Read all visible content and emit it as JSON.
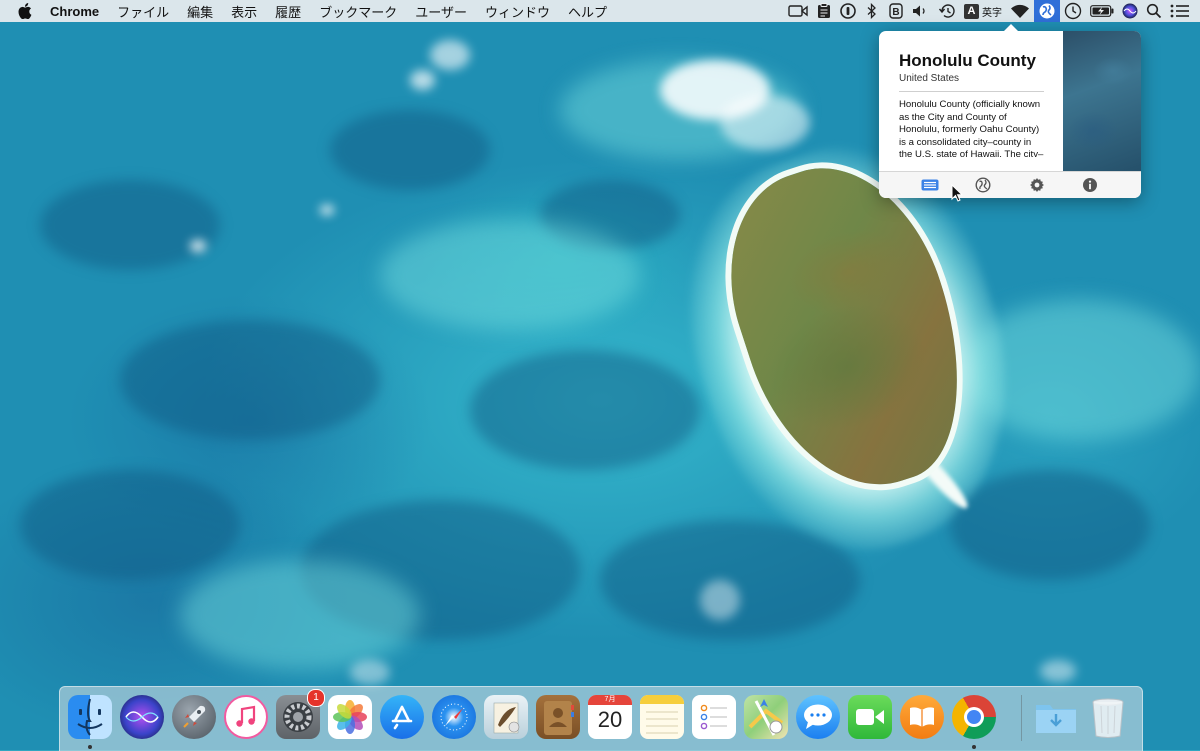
{
  "menubar": {
    "apple_icon": "apple-logo",
    "app_name": "Chrome",
    "items": [
      "ファイル",
      "編集",
      "表示",
      "履歴",
      "ブックマーク",
      "ユーザー",
      "ウィンドウ",
      "ヘルプ"
    ],
    "status_icons": [
      "facetime-camera-icon",
      "clipboard-icon",
      "1password-icon",
      "bluetooth-icon",
      "bartender-icon",
      "volume-icon",
      "time-machine-icon",
      "input-source-icon",
      "wifi-icon",
      "globe-location-icon",
      "clock-icon",
      "battery-icon",
      "siri-icon",
      "spotlight-search-icon",
      "notification-center-icon"
    ],
    "input_source_label": "英字",
    "input_source_letter": "A"
  },
  "popover": {
    "title": "Honolulu County",
    "subtitle": "United States",
    "description": "Honolulu County (officially known as the City and County of Honolulu, formerly Oahu County) is a consolidated city–county in the U.S. state of Hawaii. The city–county",
    "toolbar": [
      "list-icon",
      "globe-icon",
      "gear-icon",
      "info-icon"
    ],
    "active_tab": "list-icon"
  },
  "dock": {
    "apps": [
      "Finder",
      "Siri",
      "Launchpad",
      "iTunes",
      "System Preferences",
      "Photos",
      "App Store",
      "Safari",
      "Mail",
      "Contacts",
      "Calendar",
      "Notes",
      "Reminders",
      "Maps",
      "Messages",
      "FaceTime",
      "iBooks",
      "Chrome",
      "Downloads",
      "Trash"
    ],
    "calendar_month": "7月",
    "calendar_day": "20",
    "system_prefs_badge": "1",
    "running": [
      "Finder",
      "Chrome"
    ]
  },
  "colors": {
    "menubar_bg": "#eceef0",
    "status_active": "#2f6fd8",
    "badge": "#e5332a",
    "ocean": "#2fa6c0"
  }
}
